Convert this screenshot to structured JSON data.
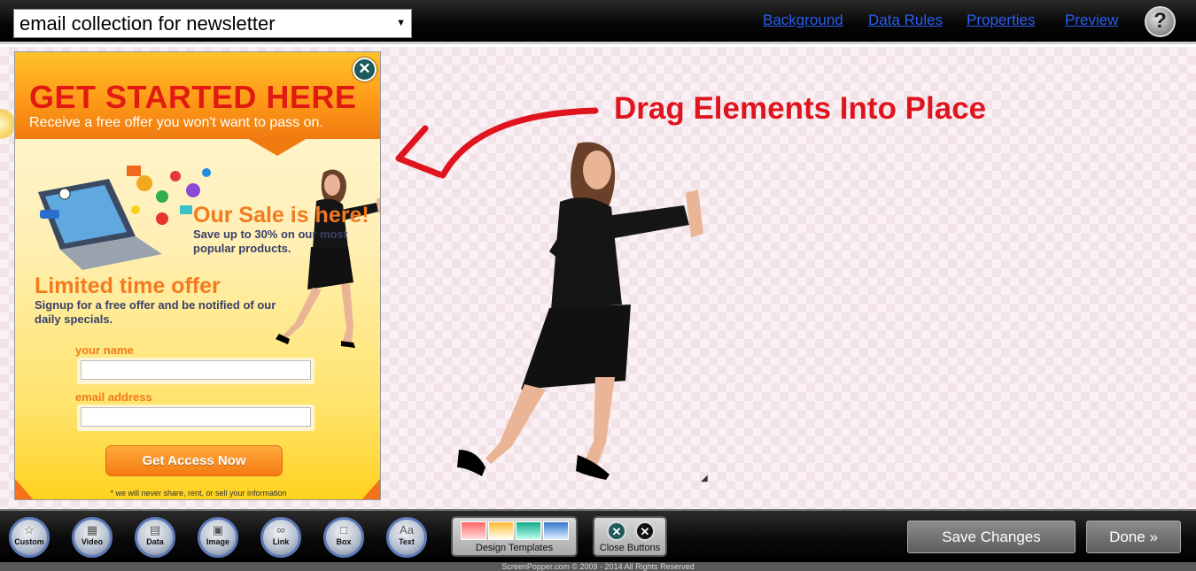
{
  "header": {
    "popup_select": "email collection for newsletter",
    "select_arrow": "▼",
    "links": [
      "Background",
      "Data Rules",
      "Properties",
      "Preview"
    ],
    "help_label": "?"
  },
  "popup": {
    "close_label": "✕",
    "title": "GET STARTED HERE",
    "subtitle": "Receive a free offer you won't want to pass on.",
    "sale_title": "Our Sale is here!",
    "sale_text": "Save up to 30% on our most popular products.",
    "limited_title": "Limited time offer",
    "limited_text": "Signup for a free offer and be notified of our daily specials.",
    "name_label": "your name",
    "email_label": "email address",
    "button_label": "Get Access Now",
    "disclaimer": "* we will never share, rent, or sell your information"
  },
  "canvas": {
    "instruction": "Drag Elements Into Place",
    "instruction_color": "#e0141e"
  },
  "toolbar": {
    "tools": [
      "Custom",
      "Video",
      "Data",
      "Image",
      "Link",
      "Box",
      "Text"
    ],
    "design_templates_label": "Design Templates",
    "close_buttons_label": "Close Buttons",
    "save_label": "Save Changes",
    "done_label": "Done",
    "done_icon": "»"
  },
  "footer": {
    "copyright": "ScreenPopper.com © 2009 - 2014 All Rights Reserved"
  },
  "colors": {
    "accent_orange": "#f37a1e",
    "title_red": "#e11a12",
    "link_blue": "#2a5ef0"
  }
}
